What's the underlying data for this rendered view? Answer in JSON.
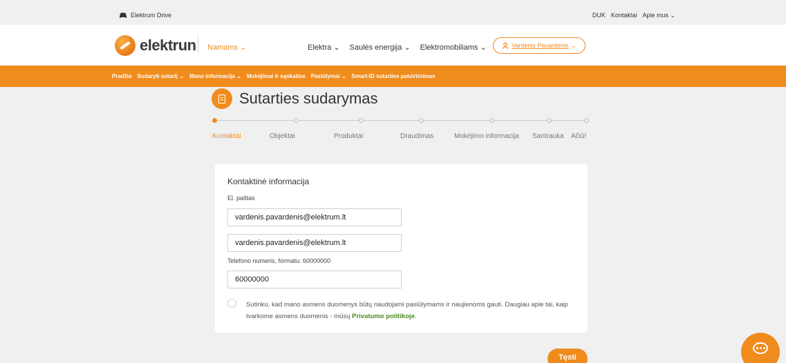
{
  "topbar": {
    "brand": "Elektrum Drive",
    "links": [
      "DUK",
      "Kontaktai",
      "Apie mus"
    ],
    "apie_chevron": "⌄"
  },
  "header": {
    "logo_text": "elektrun",
    "segment": "Namams",
    "nav": [
      "Elektra",
      "Saulės energija",
      "Elektromobiliams"
    ],
    "user_name": "Vardenis Pavardenis",
    "chevron": "⌄"
  },
  "subnav": {
    "items": [
      "Pradžia",
      "Sudaryti sutartį",
      "Mano informacija",
      "Mokėjimai ir sąskaitos",
      "Pasiūlymai",
      "Smart-ID sutarties patvirtinimas"
    ],
    "dropdown_items": [
      1,
      2,
      4
    ]
  },
  "page": {
    "title": "Sutarties sudarymas"
  },
  "stepper": {
    "steps": [
      "Kontaktai",
      "Objektai",
      "Produktai",
      "Draudimas",
      "Mokėjimo informacija",
      "Santrauka",
      "Ačiū!"
    ],
    "active_index": 0
  },
  "form": {
    "section_title": "Kontaktinė informacija",
    "email_label": "El. paštas",
    "email_value": "vardenis.pavardenis@elektrum.lt",
    "email_confirm_value": "vardenis.pavardenis@elektrum.lt",
    "phone_label": "Telefono numeris, formatu: 60000000",
    "phone_value": "60000000",
    "consent_text": "Sutinku, kad mano asmens duomenys būtų naudojami pasiūlymams ir naujienoms gauti. Daugiau apie tai, kaip tvarkome asmens duomenis - mūsų ",
    "consent_link": "Privatumo politikoje",
    "consent_end": ".",
    "consent_checked": false
  },
  "actions": {
    "next_label": "Tęsti"
  },
  "colors": {
    "accent": "#f08c1e",
    "link_green": "#4d8b23",
    "background": "#f0f0f0"
  },
  "icons": {
    "brand": "car-icon",
    "user": "user-icon",
    "title": "document-icon",
    "chat": "chat-icon"
  }
}
